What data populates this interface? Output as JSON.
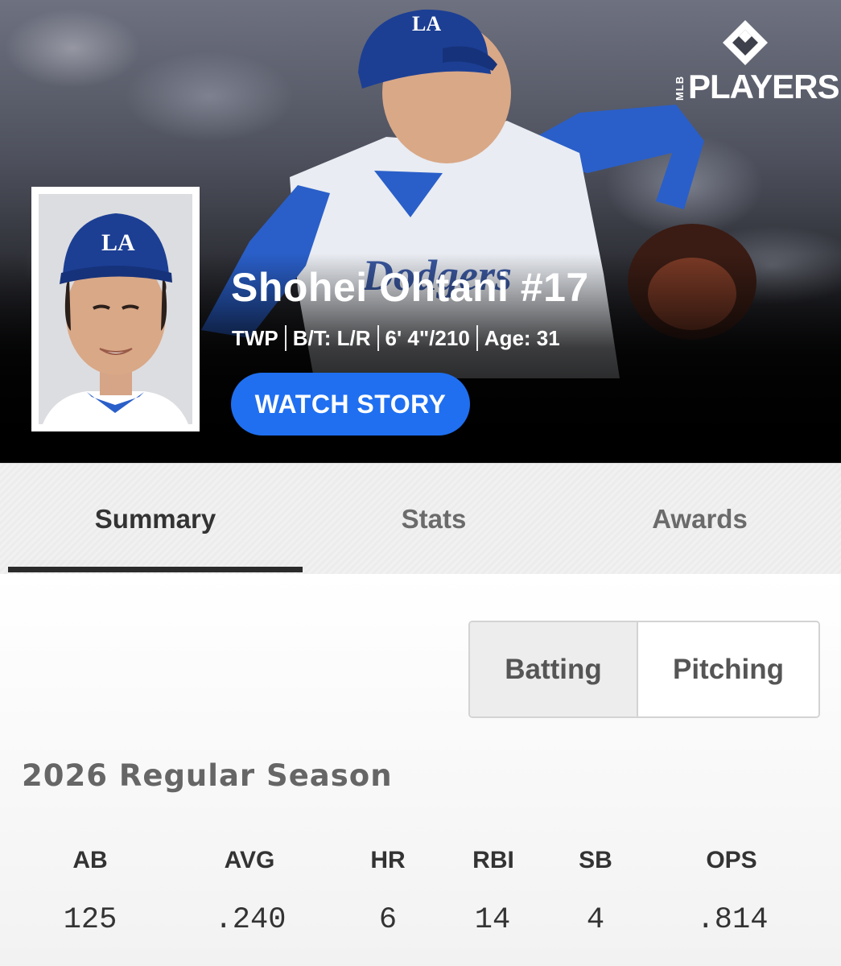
{
  "brand": {
    "mlb": "MLB",
    "text": "PLAYERS",
    "icon": "players-diamond-icon"
  },
  "hero": {
    "name": "Shohei Ohtani #17",
    "position": "TWP",
    "bats_throws": "B/T: L/R",
    "height_weight": "6' 4\"/210",
    "age": "Age: 31",
    "cta_label": "WATCH STORY",
    "cap_logo": "LA",
    "colors": {
      "cta": "#1f6ff0",
      "team_blue": "#1c3f94"
    }
  },
  "tabs": [
    {
      "label": "Summary",
      "active": true
    },
    {
      "label": "Stats",
      "active": false
    },
    {
      "label": "Awards",
      "active": false
    }
  ],
  "toggle": {
    "batting": "Batting",
    "pitching": "Pitching",
    "selected": "Batting"
  },
  "season": {
    "title": "2026 Regular Season",
    "headers": [
      "AB",
      "AVG",
      "HR",
      "RBI",
      "SB",
      "OPS"
    ],
    "values": [
      "125",
      ".240",
      "6",
      "14",
      "4",
      ".814"
    ]
  }
}
